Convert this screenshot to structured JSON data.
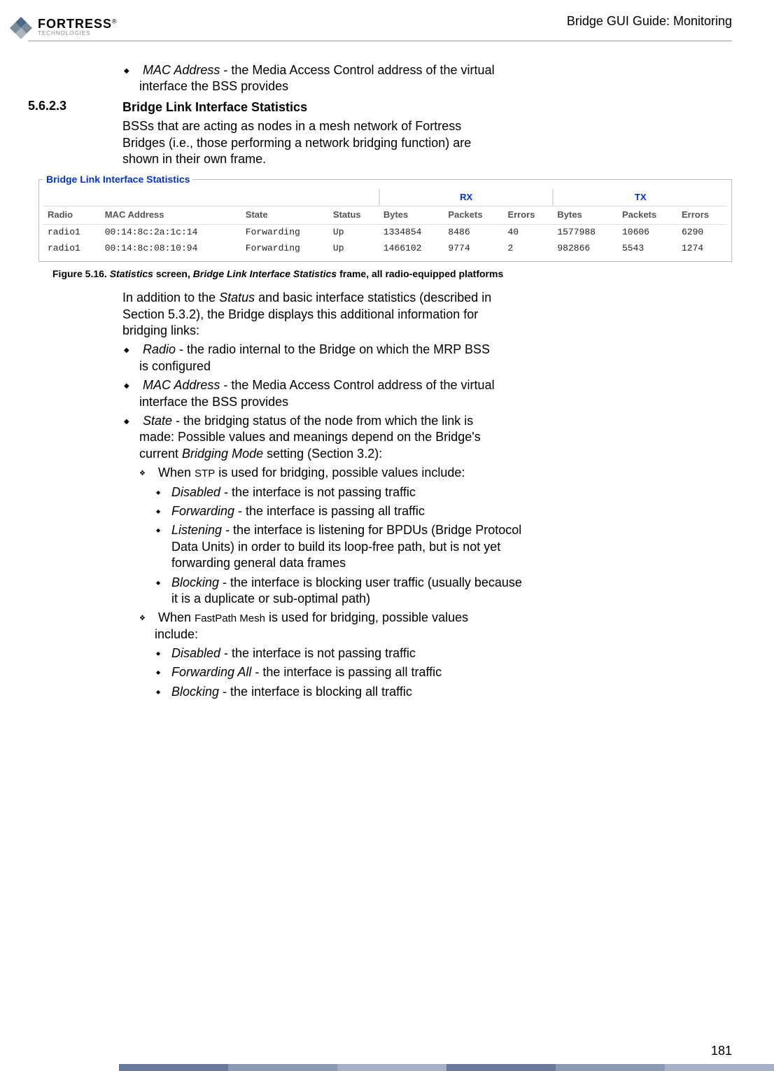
{
  "header": {
    "logo_main": "FORTRESS",
    "logo_sub": "TECHNOLOGIES",
    "reg": "®",
    "title": "Bridge GUI Guide: Monitoring"
  },
  "bullet_top": {
    "term": "MAC Address",
    "text": " - the Media Access Control address of the virtual interface the BSS provides"
  },
  "section": {
    "num": "5.6.2.3",
    "heading": "Bridge Link Interface Statistics",
    "intro": "BSSs that are acting as nodes in a mesh network of Fortress Bridges (i.e., those performing a network bridging function) are shown in their own frame."
  },
  "stats_frame": {
    "legend": "Bridge Link Interface Statistics",
    "group_rx": "RX",
    "group_tx": "TX",
    "cols": {
      "radio": "Radio",
      "mac": "MAC Address",
      "state": "State",
      "status": "Status",
      "bytes": "Bytes",
      "packets": "Packets",
      "errors": "Errors"
    },
    "rows": [
      {
        "radio": "radio1",
        "mac": "00:14:8c:2a:1c:14",
        "state": "Forwarding",
        "status": "Up",
        "rx_bytes": "1334854",
        "rx_packets": "8486",
        "rx_errors": "40",
        "tx_bytes": "1577988",
        "tx_packets": "10606",
        "tx_errors": "6290"
      },
      {
        "radio": "radio1",
        "mac": "00:14:8c:08:10:94",
        "state": "Forwarding",
        "status": "Up",
        "rx_bytes": "1466102",
        "rx_packets": "9774",
        "rx_errors": "2",
        "tx_bytes": "982866",
        "tx_packets": "5543",
        "tx_errors": "1274"
      }
    ]
  },
  "fig_caption": {
    "prefix": "Figure 5.16. ",
    "em1": "Statistics",
    "mid1": " screen, ",
    "em2": "Bridge Link Interface Statistics",
    "suffix": " frame, all radio-equipped platforms"
  },
  "body": {
    "para1_a": "In addition to the ",
    "para1_em": "Status",
    "para1_b": " and basic interface statistics (described in Section 5.3.2), the Bridge displays this additional information for bridging links:",
    "l1": [
      {
        "term": "Radio",
        "text": " - the radio internal to the Bridge on which the MRP BSS is configured"
      },
      {
        "term": "MAC Address",
        "text": " - the Media Access Control address of the virtual interface the BSS provides"
      }
    ],
    "state_term": "State",
    "state_text_a": " - the bridging status of the node from which the link is made: Possible values and meanings depend on the Bridge's current ",
    "state_em": "Bridging Mode",
    "state_text_b": " setting (Section 3.2):",
    "stp_prefix": "When ",
    "stp_sc": "STP",
    "stp_suffix": " is used for bridging, possible values include:",
    "stp_items": [
      {
        "term": "Disabled",
        "text": " - the interface is not passing traffic"
      },
      {
        "term": "Forwarding",
        "text": " - the interface is passing all traffic"
      },
      {
        "term": "Listening",
        "text": " - the interface is listening for BPDUs (Bridge Protocol Data Units) in order to build its loop-free path, but is not yet forwarding general data frames"
      },
      {
        "term": "Blocking",
        "text": " - the interface is blocking user traffic (usually because it is a duplicate or sub-optimal path)"
      }
    ],
    "fpm_prefix": "When ",
    "fpm_sc": "FastPath Mesh",
    "fpm_suffix": " is used for bridging, possible values include:",
    "fpm_items": [
      {
        "term": "Disabled",
        "text": " - the interface is not passing traffic"
      },
      {
        "term": "Forwarding All",
        "text": " - the interface is passing all traffic"
      },
      {
        "term": "Blocking",
        "text": " - the interface is blocking all traffic"
      }
    ]
  },
  "page_number": "181",
  "chart_data": {
    "type": "table",
    "title": "Bridge Link Interface Statistics",
    "columns": [
      "Radio",
      "MAC Address",
      "State",
      "Status",
      "RX Bytes",
      "RX Packets",
      "RX Errors",
      "TX Bytes",
      "TX Packets",
      "TX Errors"
    ],
    "rows": [
      [
        "radio1",
        "00:14:8c:2a:1c:14",
        "Forwarding",
        "Up",
        1334854,
        8486,
        40,
        1577988,
        10606,
        6290
      ],
      [
        "radio1",
        "00:14:8c:08:10:94",
        "Forwarding",
        "Up",
        1466102,
        9774,
        2,
        982866,
        5543,
        1274
      ]
    ]
  }
}
